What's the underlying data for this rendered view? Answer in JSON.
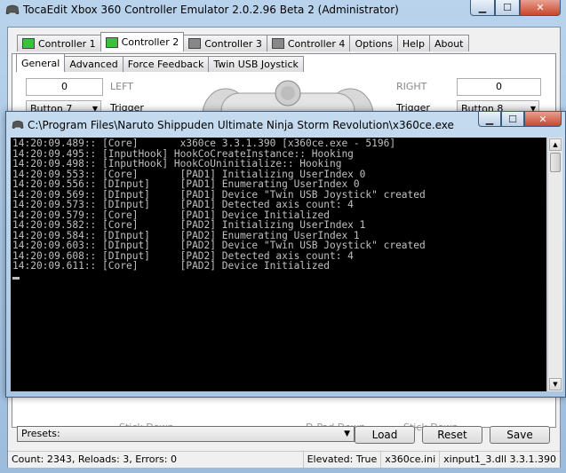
{
  "main_window": {
    "title": "TocaEdit Xbox 360 Controller Emulator 2.0.2.96 Beta 2 (Administrator)",
    "caption": {
      "minimize": "▁",
      "maximize": "☐",
      "close": "✕"
    },
    "tabs": [
      {
        "label": "Controller 1",
        "icon": "green-controller-indicator"
      },
      {
        "label": "Controller 2",
        "icon": "green-controller-indicator"
      },
      {
        "label": "Controller 3",
        "icon": "gray-controller-indicator"
      },
      {
        "label": "Controller 4",
        "icon": "gray-controller-indicator"
      },
      {
        "label": "Options"
      },
      {
        "label": "Help"
      },
      {
        "label": "About"
      }
    ],
    "selected_tab": "Controller 2",
    "sub_tabs": [
      "General",
      "Advanced",
      "Force Feedback",
      "Twin USB Joystick"
    ],
    "selected_sub_tab": "General",
    "left_value": "0",
    "left_label": "LEFT",
    "right_value": "0",
    "right_label": "RIGHT",
    "left_button_dropdown": "Button 7",
    "left_trigger_label": "Trigger",
    "right_trigger_label": "Trigger",
    "right_button_dropdown": "Button 8",
    "bottom_faded": {
      "left": "Stick Down",
      "mid": "D-Pad Down",
      "right": "Stick Down"
    },
    "presets_label": "Presets:",
    "buttons": {
      "load": "Load",
      "reset": "Reset",
      "save": "Save"
    },
    "status": {
      "counts": "Count: 2343, Reloads: 3, Errors: 0",
      "elevated": "Elevated: True",
      "ini": "x360ce.ini",
      "dll": "xinput1_3.dll 3.3.1.390"
    }
  },
  "console_window": {
    "title": "C:\\Program Files\\Naruto Shippuden Ultimate Ninja Storm Revolution\\x360ce.exe",
    "lines": [
      "14:20:09.489:: [Core]       x360ce 3.3.1.390 [x360ce.exe - 5196]",
      "14:20:09.495:: [InputHook] HookCoCreateInstance:: Hooking",
      "14:20:09.498:: [InputHook] HookCoUninitialize:: Hooking",
      "14:20:09.553:: [Core]       [PAD1] Initializing UserIndex 0",
      "14:20:09.556:: [DInput]     [PAD1] Enumerating UserIndex 0",
      "14:20:09.569:: [DInput]     [PAD1] Device \"Twin USB Joystick\" created",
      "14:20:09.573:: [DInput]     [PAD1] Detected axis count: 4",
      "14:20:09.579:: [Core]       [PAD1] Device Initialized",
      "14:20:09.582:: [Core]       [PAD2] Initializing UserIndex 1",
      "14:20:09.584:: [DInput]     [PAD2] Enumerating UserIndex 1",
      "14:20:09.603:: [DInput]     [PAD2] Device \"Twin USB Joystick\" created",
      "14:20:09.608:: [DInput]     [PAD2] Detected axis count: 4",
      "14:20:09.611:: [Core]       [PAD2] Device Initialized"
    ]
  },
  "colors": {
    "console_bg": "#000000",
    "console_text": "#c0c0c0",
    "close_button": "#c7452d",
    "indicator_on": "#3cc13c"
  }
}
